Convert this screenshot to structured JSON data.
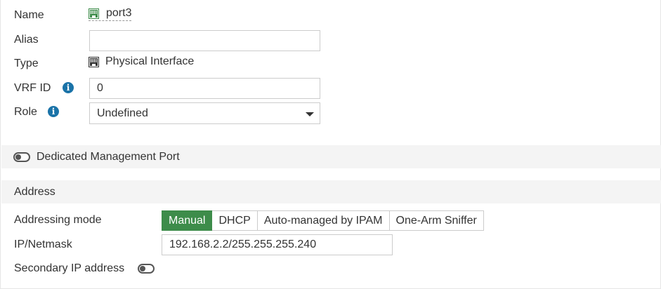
{
  "fields": {
    "name": {
      "label": "Name",
      "value": "port3",
      "icon": "ethernet-port-icon"
    },
    "alias": {
      "label": "Alias",
      "value": ""
    },
    "type": {
      "label": "Type",
      "value": "Physical Interface",
      "icon": "physical-interface-icon"
    },
    "vrf_id": {
      "label": "VRF ID",
      "value": "0",
      "info_icon": "info-icon"
    },
    "role": {
      "label": "Role",
      "value": "Undefined",
      "info_icon": "info-icon"
    }
  },
  "dedicated_management": {
    "label": "Dedicated Management Port",
    "enabled": false
  },
  "address": {
    "section_title": "Address",
    "addressing_mode": {
      "label": "Addressing mode",
      "options": [
        "Manual",
        "DHCP",
        "Auto-managed by IPAM",
        "One-Arm Sniffer"
      ],
      "selected": "Manual"
    },
    "ip_netmask": {
      "label": "IP/Netmask",
      "value": "192.168.2.2/255.255.255.240"
    },
    "secondary_ip": {
      "label": "Secondary IP address",
      "enabled": false
    }
  },
  "colors": {
    "accent_green": "#3d8c4a",
    "info_blue": "#1a73a8",
    "band_gray": "#f4f4f4",
    "border_gray": "#cccccc"
  }
}
